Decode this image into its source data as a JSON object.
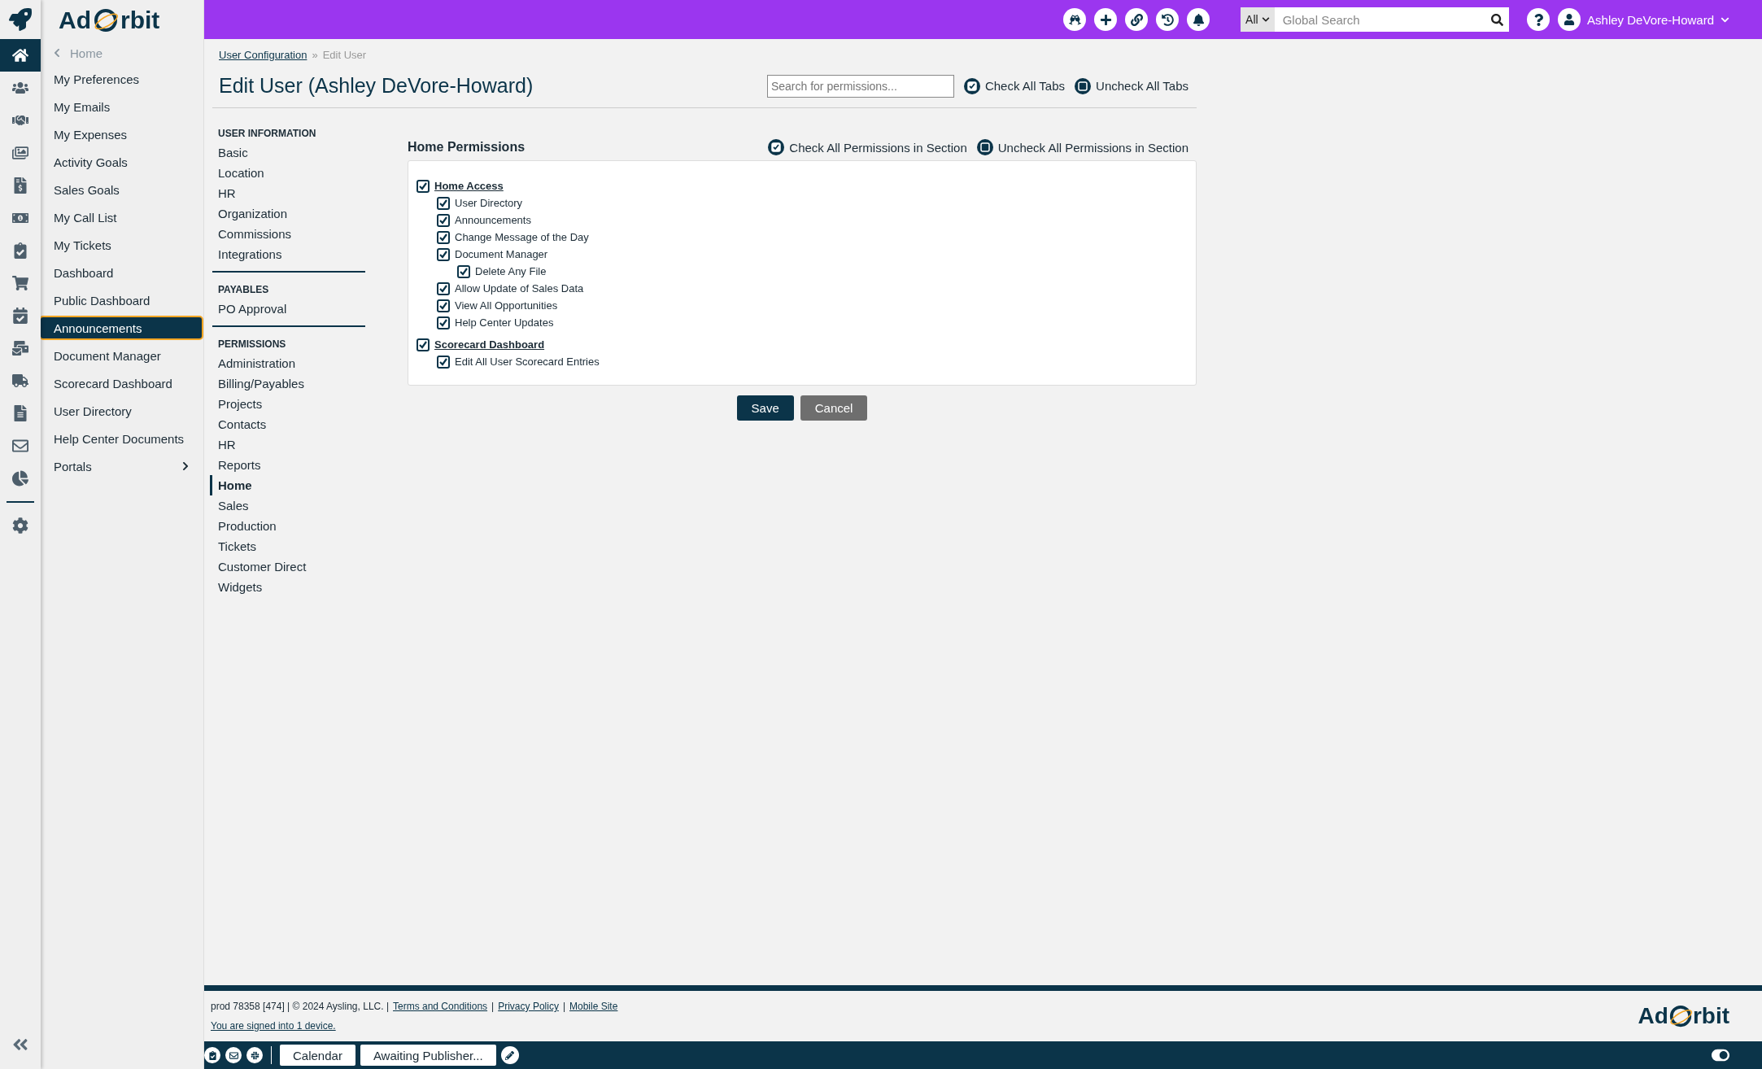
{
  "logo": {
    "left": "Ad",
    "right": "rbit"
  },
  "rail_items": [
    {
      "selected": true
    },
    {
      "selected": false
    },
    {
      "selected": false
    },
    {
      "selected": false
    },
    {
      "selected": false
    },
    {
      "selected": false
    },
    {
      "selected": false
    },
    {
      "selected": false
    },
    {
      "selected": false
    },
    {
      "selected": false
    },
    {
      "selected": false
    },
    {
      "selected": false
    },
    {
      "selected": false
    },
    {
      "selected": false
    }
  ],
  "sidebar": {
    "back": "Home",
    "items": [
      {
        "label": "My Preferences",
        "selected": false,
        "submenu": false
      },
      {
        "label": "My Emails",
        "selected": false,
        "submenu": false
      },
      {
        "label": "My Expenses",
        "selected": false,
        "submenu": false
      },
      {
        "label": "Activity Goals",
        "selected": false,
        "submenu": false
      },
      {
        "label": "Sales Goals",
        "selected": false,
        "submenu": false
      },
      {
        "label": "My Call List",
        "selected": false,
        "submenu": false
      },
      {
        "label": "My Tickets",
        "selected": false,
        "submenu": false
      },
      {
        "label": "Dashboard",
        "selected": false,
        "submenu": false
      },
      {
        "label": "Public Dashboard",
        "selected": false,
        "submenu": false
      },
      {
        "label": "Announcements",
        "selected": true,
        "submenu": false
      },
      {
        "label": "Document Manager",
        "selected": false,
        "submenu": false
      },
      {
        "label": "Scorecard Dashboard",
        "selected": false,
        "submenu": false
      },
      {
        "label": "User Directory",
        "selected": false,
        "submenu": false
      },
      {
        "label": "Help Center Documents",
        "selected": false,
        "submenu": false
      },
      {
        "label": "Portals",
        "selected": false,
        "submenu": true
      }
    ]
  },
  "topbar": {
    "search_scope": "All",
    "search_placeholder": "Global Search",
    "user": "Ashley DeVore-Howard"
  },
  "breadcrumb": {
    "link": "User Configuration",
    "separator": "»",
    "current": "Edit User"
  },
  "title": "Edit User (Ashley DeVore-Howard)",
  "permission_search": {
    "placeholder": "Search for permissions..."
  },
  "tab_actions": [
    "Check All Tabs",
    "Uncheck All Tabs"
  ],
  "nav_sections": [
    {
      "title": "USER INFORMATION",
      "items": [
        {
          "label": "Basic",
          "selected": false
        },
        {
          "label": "Location",
          "selected": false
        },
        {
          "label": "HR",
          "selected": false
        },
        {
          "label": "Organization",
          "selected": false
        },
        {
          "label": "Commissions",
          "selected": false
        },
        {
          "label": "Integrations",
          "selected": false
        }
      ]
    },
    {
      "title": "PAYABLES",
      "items": [
        {
          "label": "PO Approval",
          "selected": false
        }
      ]
    },
    {
      "title": "PERMISSIONS",
      "items": [
        {
          "label": "Administration",
          "selected": false
        },
        {
          "label": "Billing/Payables",
          "selected": false
        },
        {
          "label": "Projects",
          "selected": false
        },
        {
          "label": "Contacts",
          "selected": false
        },
        {
          "label": "HR",
          "selected": false
        },
        {
          "label": "Reports",
          "selected": false
        },
        {
          "label": "Home",
          "selected": true
        },
        {
          "label": "Sales",
          "selected": false
        },
        {
          "label": "Production",
          "selected": false
        },
        {
          "label": "Tickets",
          "selected": false
        },
        {
          "label": "Customer Direct",
          "selected": false
        },
        {
          "label": "Widgets",
          "selected": false
        }
      ]
    }
  ],
  "section": {
    "title": "Home Permissions",
    "actions": [
      "Check All Permissions in Section",
      "Uncheck All Permissions in Section"
    ],
    "permissions": [
      {
        "label": "Home Access",
        "checked": true,
        "children": [
          {
            "label": "User Directory",
            "checked": true
          },
          {
            "label": "Announcements",
            "checked": true
          },
          {
            "label": "Change Message of the Day",
            "checked": true
          },
          {
            "label": "Document Manager",
            "checked": true,
            "children": [
              {
                "label": "Delete Any File",
                "checked": true
              }
            ]
          },
          {
            "label": "Allow Update of Sales Data",
            "checked": true
          },
          {
            "label": "View All Opportunities",
            "checked": true
          },
          {
            "label": "Help Center Updates",
            "checked": true
          }
        ]
      },
      {
        "label": "Scorecard Dashboard",
        "checked": true,
        "children": [
          {
            "label": "Edit All User Scorecard Entries",
            "checked": true
          }
        ]
      }
    ]
  },
  "buttons": [
    "Save",
    "Cancel"
  ],
  "footer": {
    "info": "prod 78358 [474] | © 2024 Aysling, LLC. |",
    "links": [
      "Terms and Conditions",
      "Privacy Policy",
      "Mobile Site"
    ],
    "separators": [
      "|",
      "|"
    ],
    "signed_in": "You are signed into 1 device.",
    "logo": {
      "left": "Ad",
      "right": "rbit"
    }
  },
  "taskbar": {
    "tabs": [
      "Calendar",
      "Awaiting Publisher..."
    ]
  }
}
